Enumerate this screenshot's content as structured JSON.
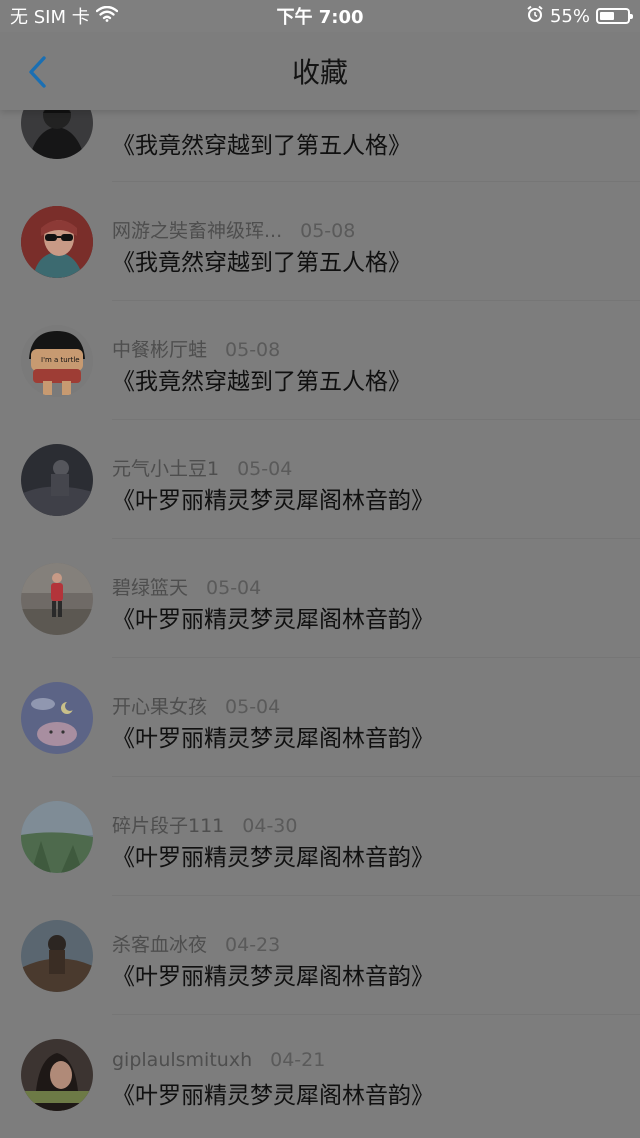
{
  "status_bar": {
    "carrier": "无 SIM 卡",
    "time": "下午 7:00",
    "battery_percent": "55%",
    "battery_level": 0.55
  },
  "nav": {
    "title": "收藏",
    "back_icon": "chevron-left-icon",
    "accent_color": "#1a6fb3"
  },
  "favorites": [
    {
      "user": "",
      "date": "",
      "title": "《我竟然穿越到了第五人格》"
    },
    {
      "user": "网游之奘畜神级珲...",
      "date": "05-08",
      "title": "《我竟然穿越到了第五人格》"
    },
    {
      "user": "中餐彬厅蛙",
      "date": "05-08",
      "title": "《我竟然穿越到了第五人格》"
    },
    {
      "user": "元气小土豆1",
      "date": "05-04",
      "title": "《叶罗丽精灵梦灵犀阁林音韵》"
    },
    {
      "user": "碧绿篮天",
      "date": "05-04",
      "title": "《叶罗丽精灵梦灵犀阁林音韵》"
    },
    {
      "user": "开心果女孩",
      "date": "05-04",
      "title": "《叶罗丽精灵梦灵犀阁林音韵》"
    },
    {
      "user": "碎片段子111",
      "date": "04-30",
      "title": "《叶罗丽精灵梦灵犀阁林音韵》"
    },
    {
      "user": "杀客血冰夜",
      "date": "04-23",
      "title": "《叶罗丽精灵梦灵犀阁林音韵》"
    },
    {
      "user": "giplaulsmituxh",
      "date": "04-21",
      "title": "《叶罗丽精灵梦灵犀阁林音韵》"
    }
  ]
}
